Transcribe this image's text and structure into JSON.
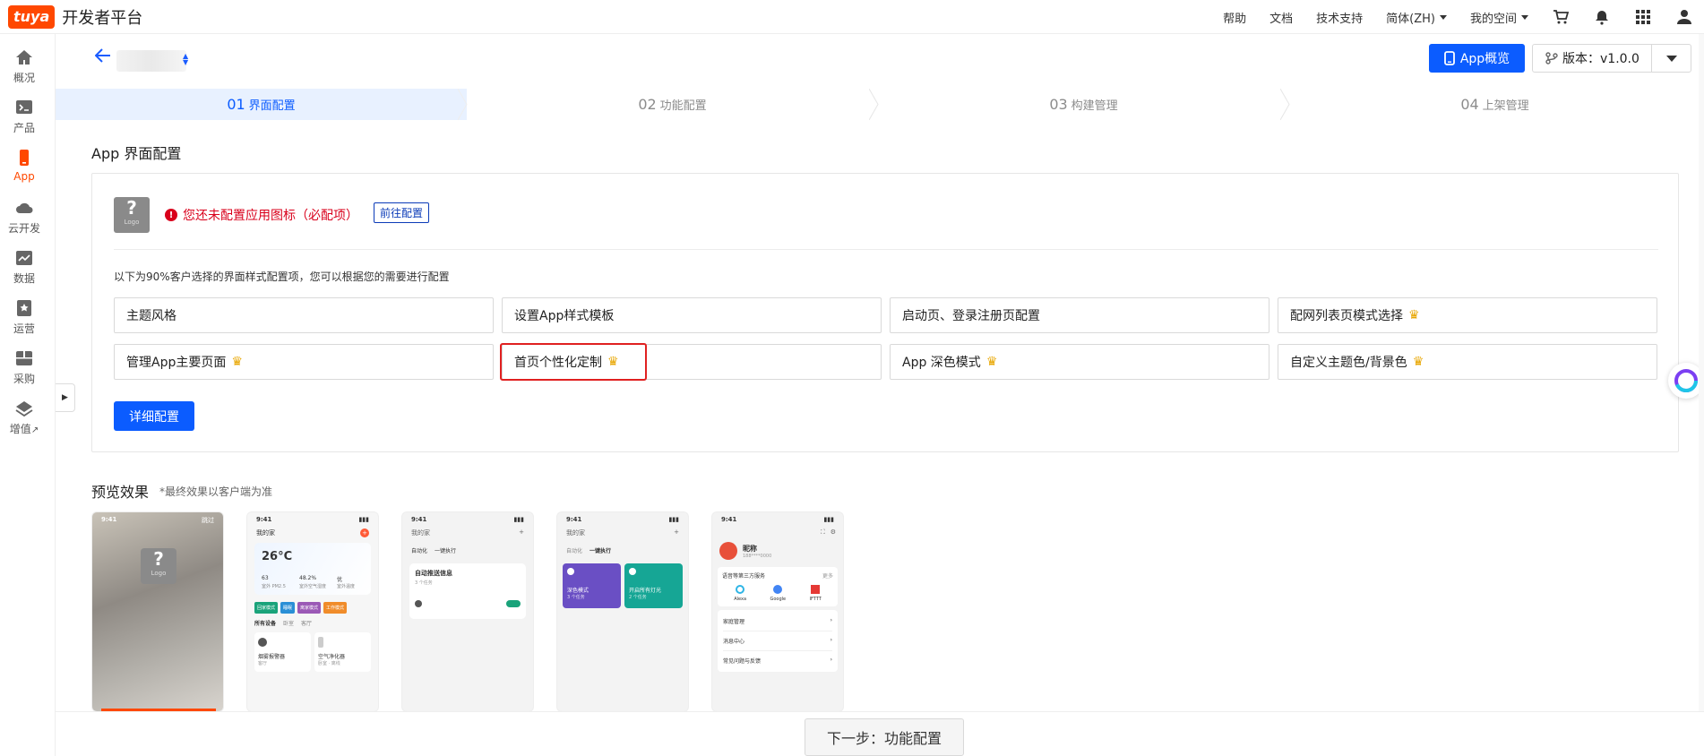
{
  "brand": {
    "badge": "tuya",
    "name": "开发者平台"
  },
  "topnav": {
    "help": "帮助",
    "docs": "文档",
    "support": "技术支持",
    "language": "简体(ZH)",
    "space": "我的空间"
  },
  "sidebar": {
    "items": [
      {
        "label": "概况",
        "icon": "home-icon"
      },
      {
        "label": "产品",
        "icon": "product-icon"
      },
      {
        "label": "App",
        "icon": "app-icon"
      },
      {
        "label": "云开发",
        "icon": "cloud-icon"
      },
      {
        "label": "数据",
        "icon": "data-icon"
      },
      {
        "label": "运营",
        "icon": "operate-icon"
      },
      {
        "label": "采购",
        "icon": "purchase-icon"
      },
      {
        "label": "增值",
        "icon": "value-added-icon"
      }
    ]
  },
  "header": {
    "overview_label": "App概览",
    "version_label": "版本：v1.0.0"
  },
  "steps": [
    {
      "num": "01",
      "label": "界面配置"
    },
    {
      "num": "02",
      "label": "功能配置"
    },
    {
      "num": "03",
      "label": "构建管理"
    },
    {
      "num": "04",
      "label": "上架管理"
    }
  ],
  "main": {
    "title": "App 界面配置",
    "logo_q": "?",
    "logo_text": "Logo",
    "warning": "您还未配置应用图标（必配项）",
    "goto_label": "前往配置",
    "hint": "以下为90%客户选择的界面样式配置项，您可以根据您的需要进行配置",
    "options": [
      {
        "label": "主题风格",
        "crown": false
      },
      {
        "label": "设置App样式模板",
        "crown": false
      },
      {
        "label": "启动页、登录注册页配置",
        "crown": false
      },
      {
        "label": "配网列表页模式选择",
        "crown": true
      },
      {
        "label": "管理App主要页面",
        "crown": true
      },
      {
        "label": "首页个性化定制",
        "crown": true
      },
      {
        "label": "App 深色模式",
        "crown": true
      },
      {
        "label": "自定义主题色/背景色",
        "crown": true
      }
    ],
    "detail_label": "详细配置"
  },
  "preview": {
    "title": "预览效果",
    "note": "*最终效果以客户端为准",
    "time": "9:41",
    "p1": {
      "skip": "跳过"
    },
    "p2": {
      "home": "我的家",
      "temp": "26°C",
      "aqi": "63",
      "aqi_label": "室外 PM2.5",
      "hum": "48.2%",
      "hum_label": "室外空气湿度",
      "level": "优",
      "level_label": "室外温度",
      "chips": [
        "回家模式",
        "睡眠",
        "离家模式",
        "工作模式"
      ],
      "tabs": [
        "所有设备",
        "卧室",
        "客厅"
      ],
      "dev1": "烟雾报警器",
      "dev1_sub": "客厅",
      "dev2": "空气净化器",
      "dev2_sub": "卧室 · 离线"
    },
    "p3": {
      "home": "我的家",
      "tab1": "自动化",
      "tab2": "一键执行",
      "card_title": "自动推送信息",
      "card_sub": "3 个任务"
    },
    "p4": {
      "home": "我的家",
      "tab1": "自动化",
      "tab2": "一键执行",
      "card1": "深色模式",
      "card1_sub": "3 个任务",
      "card2": "开启所有灯光",
      "card2_sub": "2 个任务"
    },
    "p5": {
      "nickname": "昵称",
      "account": "188****0000",
      "services": "语音等第三方服务",
      "more": "更多",
      "svc": [
        "Alexa",
        "Google",
        "IFTTT"
      ],
      "menu": [
        "家庭管理",
        "消息中心",
        "常见问题与反馈"
      ]
    }
  },
  "footer": {
    "next_label": "下一步：功能配置"
  },
  "colors": {
    "primary": "#0b5cff",
    "brand": "#ff4800",
    "warning": "#d9001b",
    "highlight": "#e02020"
  }
}
